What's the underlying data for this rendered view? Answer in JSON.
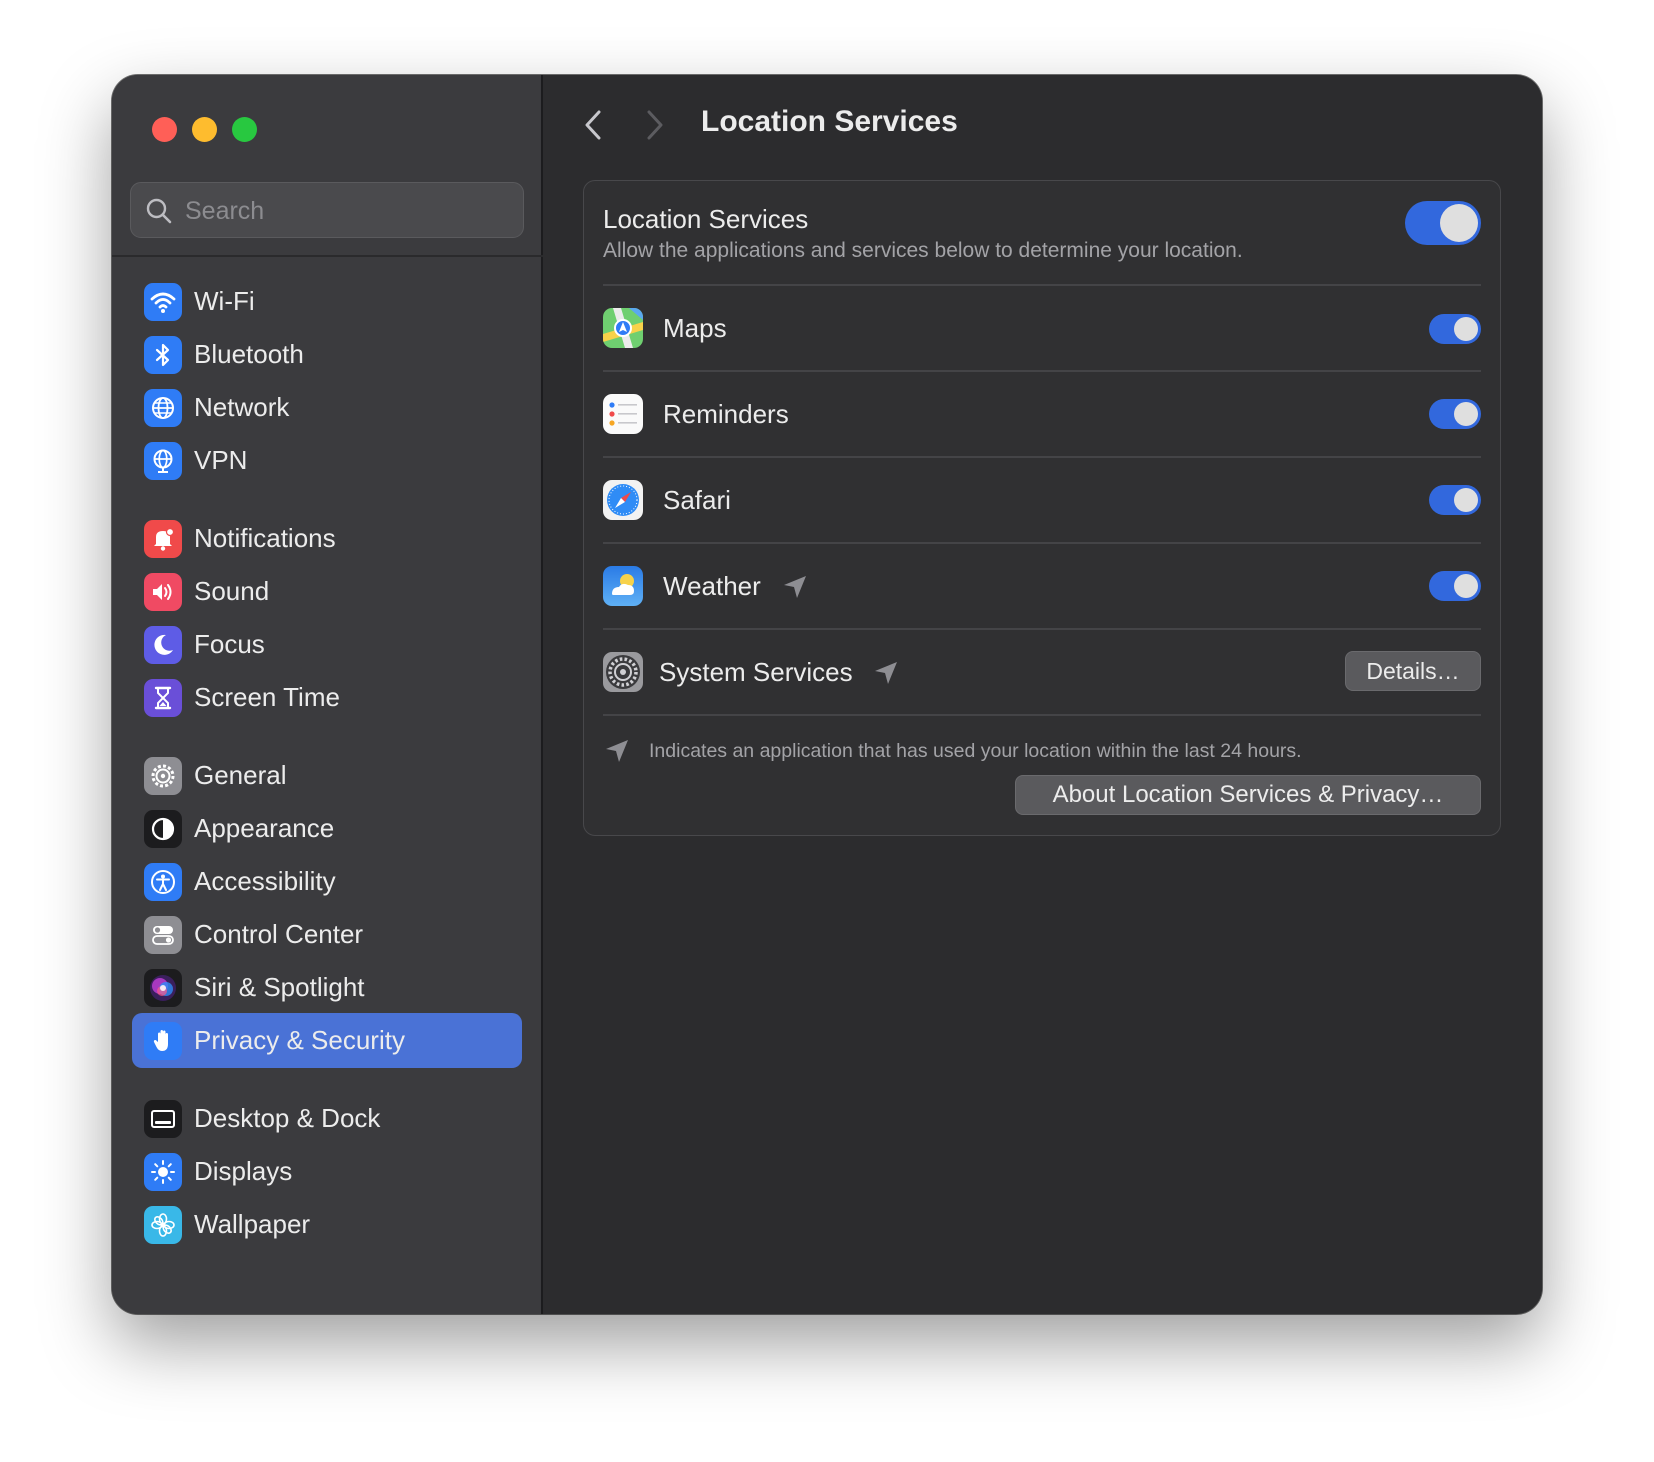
{
  "window": {
    "title": "Location Services"
  },
  "sidebar": {
    "search_placeholder": "Search",
    "items": [
      {
        "label": "Wi-Fi",
        "icon": "wifi-icon",
        "color": "#2f7cf6"
      },
      {
        "label": "Bluetooth",
        "icon": "bluetooth-icon",
        "color": "#2f7cf6"
      },
      {
        "label": "Network",
        "icon": "globe-icon",
        "color": "#2f7cf6"
      },
      {
        "label": "VPN",
        "icon": "vpn-globe-icon",
        "color": "#2f7cf6"
      },
      {
        "label": "Notifications",
        "icon": "bell-icon",
        "color": "#f04a4a"
      },
      {
        "label": "Sound",
        "icon": "speaker-icon",
        "color": "#f04a63"
      },
      {
        "label": "Focus",
        "icon": "moon-icon",
        "color": "#5e5ce6"
      },
      {
        "label": "Screen Time",
        "icon": "hourglass-icon",
        "color": "#6a4fd8"
      },
      {
        "label": "General",
        "icon": "gear-icon",
        "color": "#8e8e93"
      },
      {
        "label": "Appearance",
        "icon": "appearance-icon",
        "color": "#1c1c1e"
      },
      {
        "label": "Accessibility",
        "icon": "accessibility-icon",
        "color": "#2f7cf6"
      },
      {
        "label": "Control Center",
        "icon": "toggles-icon",
        "color": "#8e8e93"
      },
      {
        "label": "Siri & Spotlight",
        "icon": "siri-icon",
        "color": "#b04adf"
      },
      {
        "label": "Privacy & Security",
        "icon": "hand-icon",
        "color": "#2f7cf6",
        "active": true
      },
      {
        "label": "Desktop & Dock",
        "icon": "dock-icon",
        "color": "#1c1c1e"
      },
      {
        "label": "Displays",
        "icon": "sun-icon",
        "color": "#2f7cf6"
      },
      {
        "label": "Wallpaper",
        "icon": "flower-icon",
        "color": "#39b8e8"
      }
    ]
  },
  "main": {
    "title": "Location Services",
    "location_services": {
      "title": "Location Services",
      "description": "Allow the applications and services below to determine your location.",
      "enabled": true
    },
    "apps": [
      {
        "name": "Maps",
        "icon": "maps-icon",
        "enabled": true,
        "recent": false
      },
      {
        "name": "Reminders",
        "icon": "reminders-icon",
        "enabled": true,
        "recent": false
      },
      {
        "name": "Safari",
        "icon": "safari-icon",
        "enabled": true,
        "recent": false
      },
      {
        "name": "Weather",
        "icon": "weather-icon",
        "enabled": true,
        "recent": true
      }
    ],
    "system_services": {
      "name": "System Services",
      "button": "Details…",
      "recent": true
    },
    "legend": "Indicates an application that has used your location within the last 24 hours.",
    "about_button": "About Location Services & Privacy…"
  },
  "colors": {
    "accent": "#3268dd",
    "sidebar_active": "#4a72d6"
  }
}
